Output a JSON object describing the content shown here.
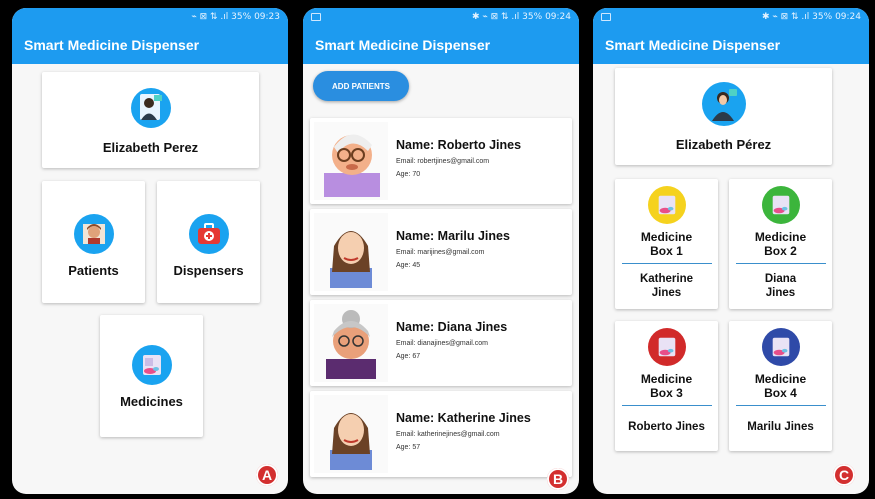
{
  "status": {
    "time_a": "09:23",
    "time_b": "09:24",
    "time_c": "09:24",
    "battery": "35%",
    "signal_a": "⌁ ⊠ ⇅ .ıl",
    "signal_b": "✱ ⌁ ⊠ ⇅ .ıl",
    "signal_c": "✱ ⌁ ⊠ ⇅ .ıl"
  },
  "colors": {
    "appbar": "#1d9bf0",
    "accent": "#1aa3f0",
    "marker": "#d32f2f"
  },
  "app": {
    "title": "Smart Medicine Dispenser"
  },
  "screen_a": {
    "user_name": "Elizabeth Perez",
    "patients_label": "Patients",
    "dispensers_label": "Dispensers",
    "medicines_label": "Medicines",
    "marker": "A"
  },
  "screen_b": {
    "add_button": "ADD PATIENTS",
    "patients": [
      {
        "name": "Name: Roberto Jines",
        "email": "Email: robertjines@gmail.com",
        "age": "Age: 70"
      },
      {
        "name": "Name: Marilu Jines",
        "email": "Email: marijines@gmail.com",
        "age": "Age: 45"
      },
      {
        "name": "Name: Diana Jines",
        "email": "Email: dianajines@gmail.com",
        "age": "Age: 67"
      },
      {
        "name": "Name: Katherine Jines",
        "email": "Email: katherinejines@gmail.com",
        "age": "Age: 57"
      }
    ],
    "marker": "B"
  },
  "screen_c": {
    "user_name": "Elizabeth Pérez",
    "boxes": [
      {
        "line1": "Medicine",
        "line2": "Box 1",
        "who1": "Katherine",
        "who2": "Jines",
        "color": "#f5d21e"
      },
      {
        "line1": "Medicine",
        "line2": "Box 2",
        "who1": "Diana",
        "who2": "Jines",
        "color": "#3cb53c"
      },
      {
        "line1": "Medicine",
        "line2": "Box 3",
        "who1": "Roberto Jines",
        "who2": "",
        "color": "#d12a2a"
      },
      {
        "line1": "Medicine",
        "line2": "Box 4",
        "who1": "Marilu Jines",
        "who2": "",
        "color": "#2f4aa8"
      }
    ],
    "marker": "C"
  }
}
